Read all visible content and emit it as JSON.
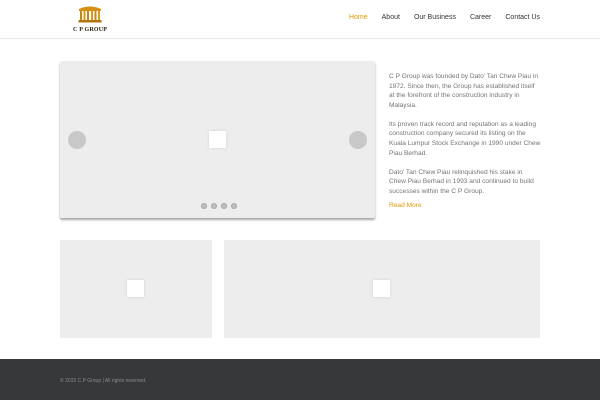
{
  "brand": {
    "name": "C P GROUP",
    "logo_icon": "pillars-logo-icon",
    "accent_color": "#e09900"
  },
  "nav": {
    "items": [
      {
        "label": "Home",
        "active": true
      },
      {
        "label": "About",
        "active": false
      },
      {
        "label": "Our Business",
        "active": false
      },
      {
        "label": "Career",
        "active": false
      },
      {
        "label": "Contact Us",
        "active": false
      }
    ]
  },
  "slider": {
    "prev_icon": "circle-prev-icon",
    "next_icon": "circle-next-icon",
    "slide_count": 4
  },
  "about": {
    "paragraphs": [
      "C P Group was founded by Dato' Tan Chew Piau in 1972. Since then, the Group has established itself at the forefront of the construction industry in Malaysia.",
      "Its proven track record and reputation as a leading construction company secured its listing on the Kuala Lumpur Stock Exchange in 1990 under Chew Piau Berhad.",
      "Dato' Tan Chew Piau relinquished his stake in Chew Piau Berhad in 1993 and continued to build successes within the C P Group."
    ],
    "read_more": "Read More"
  },
  "footer": {
    "copyright": "© 2015 C P Group | All rights reserved."
  }
}
